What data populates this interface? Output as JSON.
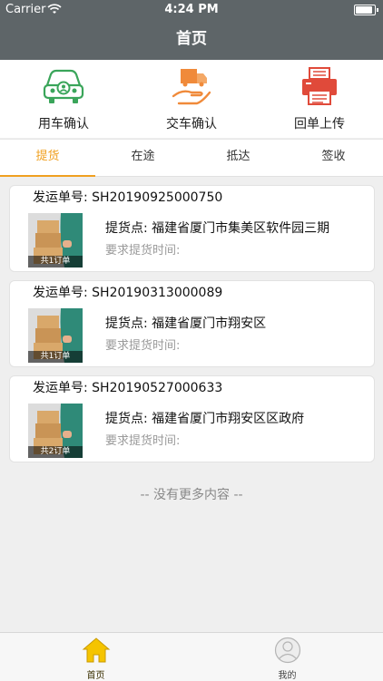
{
  "status_bar": {
    "carrier": "Carrier",
    "time": "4:24 PM"
  },
  "navbar": {
    "title": "首页"
  },
  "quick_actions": [
    {
      "label": "用车确认",
      "icon": "car-confirm-icon",
      "color": "#3aa55a"
    },
    {
      "label": "交车确认",
      "icon": "truck-handover-icon",
      "color": "#f08a3a"
    },
    {
      "label": "回单上传",
      "icon": "printer-upload-icon",
      "color": "#e04a3a"
    }
  ],
  "tabs": [
    {
      "label": "提货",
      "active": true
    },
    {
      "label": "在途",
      "active": false
    },
    {
      "label": "抵达",
      "active": false
    },
    {
      "label": "签收",
      "active": false
    }
  ],
  "orders": [
    {
      "order_label": "发运单号:  SH20190925000750",
      "thumb_caption": "共1订单",
      "pickup": "提货点:  福建省厦门市集美区软件园三期",
      "required_time": "要求提货时间:"
    },
    {
      "order_label": "发运单号:  SH20190313000089",
      "thumb_caption": "共1订单",
      "pickup": "提货点:  福建省厦门市翔安区",
      "required_time": "要求提货时间:"
    },
    {
      "order_label": "发运单号:  SH20190527000633",
      "thumb_caption": "共2订单",
      "pickup": "提货点:  福建省厦门市翔安区区政府",
      "required_time": "要求提货时间:"
    }
  ],
  "list_footer": "-- 没有更多内容 --",
  "tab_bar": [
    {
      "label": "首页",
      "icon": "home-icon",
      "active": true
    },
    {
      "label": "我的",
      "icon": "profile-icon",
      "active": false
    }
  ],
  "colors": {
    "header": "#5e6568",
    "accent": "#f0a020",
    "background": "#efefef"
  }
}
